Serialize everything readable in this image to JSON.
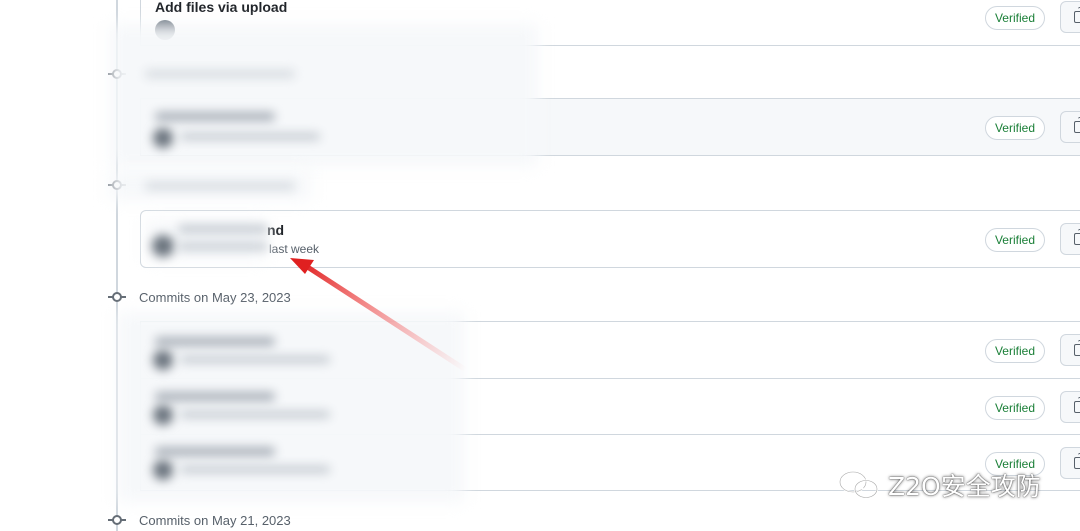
{
  "commit_groups": [
    {
      "header": "",
      "commits": [
        {
          "title": "Add files via upload",
          "meta": "",
          "status": "Verified"
        }
      ]
    },
    {
      "header": "",
      "commits": [
        {
          "title": "",
          "meta": "",
          "status": "Verified"
        }
      ]
    },
    {
      "header": "",
      "commits": [
        {
          "title": "nd",
          "meta": "last week",
          "status": "Verified"
        }
      ]
    },
    {
      "header": "Commits on May 23, 2023",
      "commits": [
        {
          "title": "",
          "meta": "",
          "status": "Verified"
        },
        {
          "title": "",
          "meta": "",
          "status": "Verified"
        },
        {
          "title": "",
          "meta": "",
          "status": "Verified"
        }
      ]
    },
    {
      "header": "Commits on May 21, 2023",
      "commits": []
    }
  ],
  "watermark": {
    "text": "Z2O安全攻防",
    "icon": "wechat-icon"
  },
  "annotation": {
    "icon": "red-arrow-icon",
    "color": "#e02020"
  },
  "colors": {
    "verified": "#1a7f37",
    "border": "#d0d7de",
    "muted": "#57606a"
  }
}
